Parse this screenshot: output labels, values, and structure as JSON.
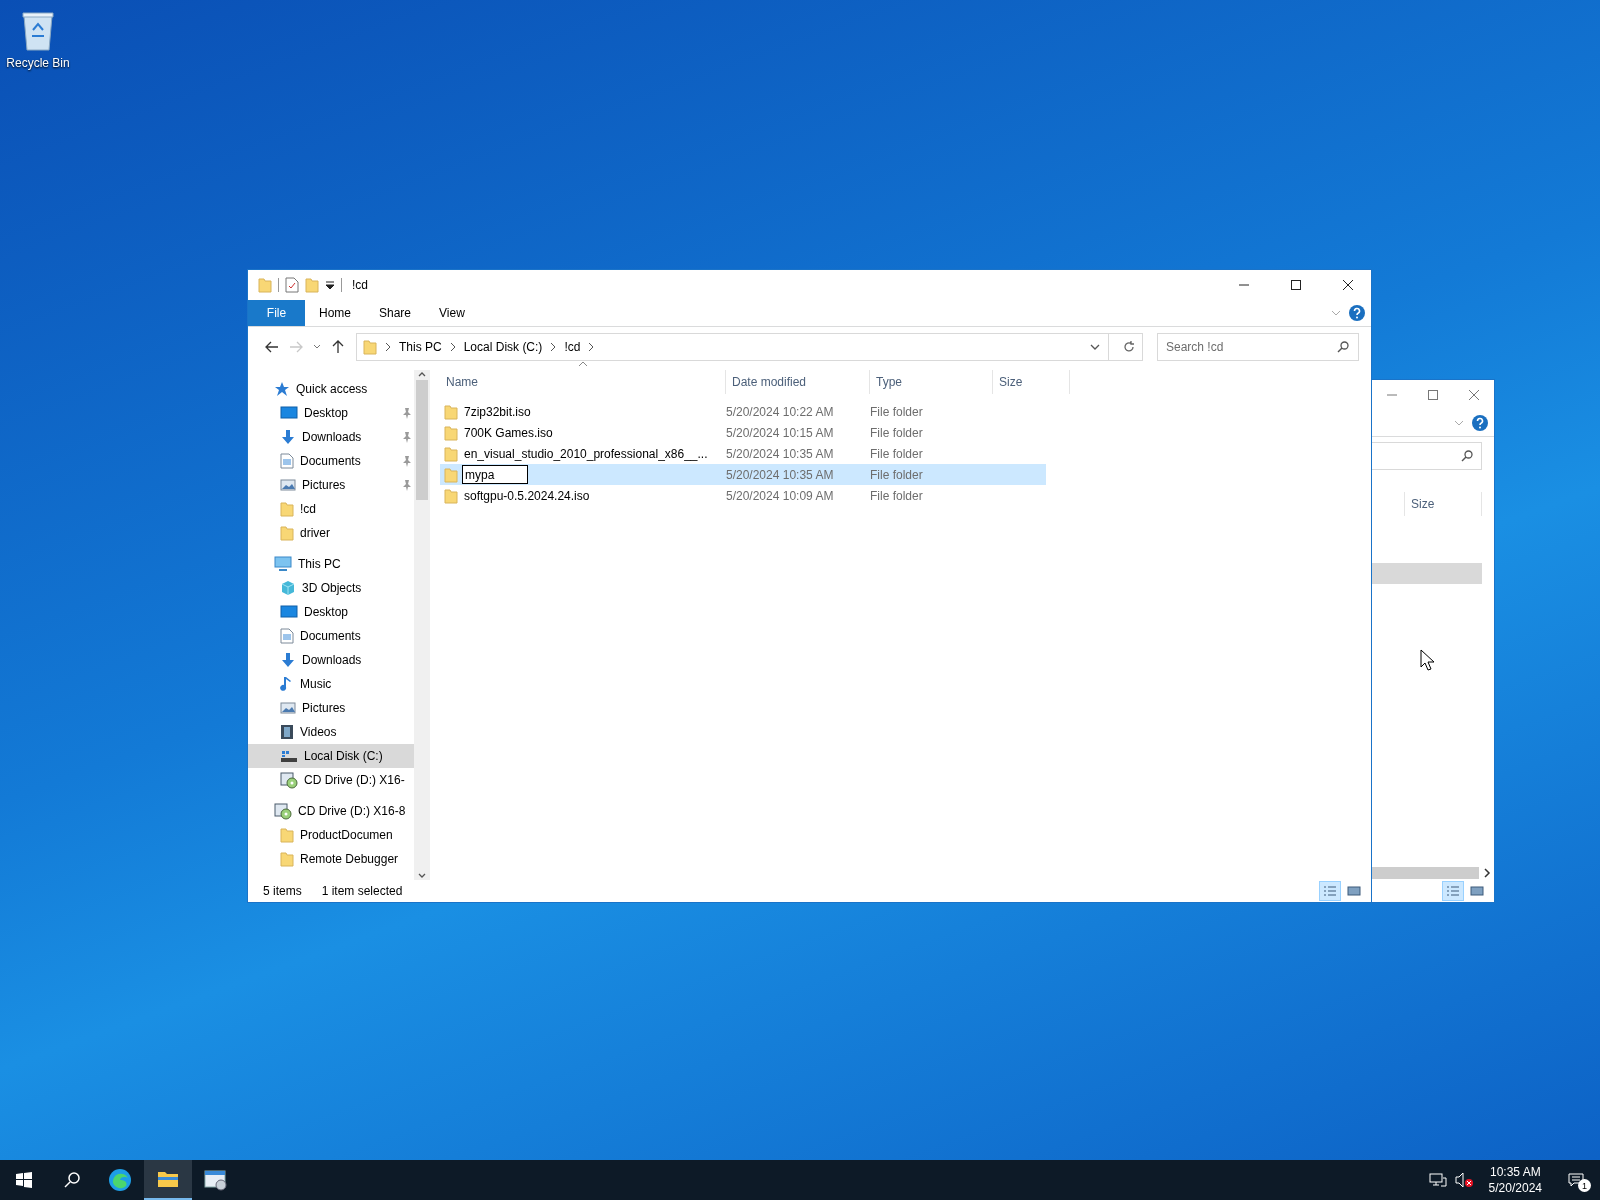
{
  "desktop_icons": [
    {
      "label": "Recycle Bin"
    }
  ],
  "explorer": {
    "title": "!cd",
    "ribbon_tabs": [
      {
        "label": "File",
        "kind": "file"
      },
      {
        "label": "Home",
        "kind": "tab"
      },
      {
        "label": "Share",
        "kind": "tab"
      },
      {
        "label": "View",
        "kind": "tab"
      }
    ],
    "address": [
      "This PC",
      "Local Disk (C:)",
      "!cd"
    ],
    "search": {
      "placeholder": "Search !cd"
    },
    "nav": [
      {
        "label": "Quick access",
        "kind": "star",
        "selected": false,
        "children": [
          {
            "label": "Desktop",
            "kind": "desktop",
            "pinned": true,
            "selected": false
          },
          {
            "label": "Downloads",
            "kind": "download",
            "pinned": true,
            "selected": false
          },
          {
            "label": "Documents",
            "kind": "document",
            "pinned": true,
            "selected": false
          },
          {
            "label": "Pictures",
            "kind": "picture",
            "pinned": true,
            "selected": false
          },
          {
            "label": "!cd",
            "kind": "folder",
            "pinned": false,
            "selected": false
          },
          {
            "label": "driver",
            "kind": "folder",
            "pinned": false,
            "selected": false
          }
        ]
      },
      {
        "label": "This PC",
        "kind": "pc",
        "selected": false,
        "children": [
          {
            "label": "3D Objects",
            "kind": "cube",
            "selected": false
          },
          {
            "label": "Desktop",
            "kind": "desktop",
            "selected": false
          },
          {
            "label": "Documents",
            "kind": "document",
            "selected": false
          },
          {
            "label": "Downloads",
            "kind": "download",
            "selected": false
          },
          {
            "label": "Music",
            "kind": "music",
            "selected": false
          },
          {
            "label": "Pictures",
            "kind": "picture",
            "selected": false
          },
          {
            "label": "Videos",
            "kind": "video",
            "selected": false
          },
          {
            "label": "Local Disk (C:)",
            "kind": "disk",
            "selected": true
          },
          {
            "label": "CD Drive (D:) X16-",
            "kind": "cd",
            "selected": false
          }
        ]
      },
      {
        "label": "CD Drive (D:) X16-8",
        "kind": "cd",
        "selected": false,
        "children": [
          {
            "label": "ProductDocumen",
            "kind": "folder",
            "selected": false
          },
          {
            "label": "Remote Debugger",
            "kind": "folder",
            "selected": false
          }
        ]
      }
    ],
    "columns": [
      {
        "label": "Name",
        "sorted": true
      },
      {
        "label": "Date modified",
        "sorted": false
      },
      {
        "label": "Type",
        "sorted": false
      },
      {
        "label": "Size",
        "sorted": false
      }
    ],
    "rows": [
      {
        "name": "7zip32bit.iso",
        "date": "5/20/2024 10:22 AM",
        "type": "File folder",
        "selected": false,
        "renaming": false
      },
      {
        "name": "700K Games.iso",
        "date": "5/20/2024 10:15 AM",
        "type": "File folder",
        "selected": false,
        "renaming": false
      },
      {
        "name": "en_visual_studio_2010_professional_x86__...",
        "date": "5/20/2024 10:35 AM",
        "type": "File folder",
        "selected": false,
        "renaming": false
      },
      {
        "name": "mypa",
        "date": "5/20/2024 10:35 AM",
        "type": "File folder",
        "selected": true,
        "renaming": true
      },
      {
        "name": "softgpu-0.5.2024.24.iso",
        "date": "5/20/2024 10:09 AM",
        "type": "File folder",
        "selected": false,
        "renaming": false
      }
    ],
    "status": {
      "count": "5 items",
      "selection": "1 item selected"
    },
    "views": [
      {
        "kind": "details",
        "selected": true
      },
      {
        "kind": "thumbnails",
        "selected": false
      }
    ]
  },
  "background_window": {
    "columns": [
      {
        "label": "Size"
      }
    ],
    "rows": [
      {
        "selected": true
      }
    ],
    "views": [
      {
        "kind": "details",
        "selected": true
      },
      {
        "kind": "thumbnails",
        "selected": false
      }
    ]
  },
  "taskbar": {
    "apps": [
      {
        "kind": "start",
        "selected": false
      },
      {
        "kind": "search",
        "selected": false
      },
      {
        "kind": "browser",
        "selected": false
      },
      {
        "kind": "explorer",
        "selected": true
      },
      {
        "kind": "window",
        "selected": false
      }
    ],
    "time": "10:35 AM",
    "date": "5/20/2024",
    "notifications": "1"
  }
}
